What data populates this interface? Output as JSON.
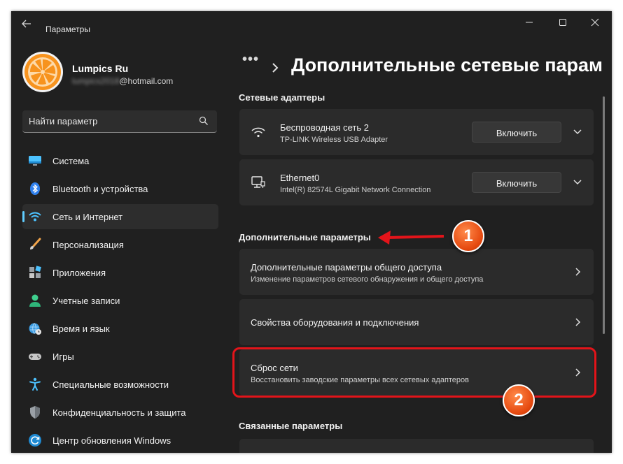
{
  "window": {
    "title": "Параметры"
  },
  "user": {
    "name": "Lumpics Ru",
    "email_hidden": "lumpics2018",
    "email_domain": "@hotmail.com"
  },
  "search": {
    "placeholder": "Найти параметр"
  },
  "nav": {
    "items": [
      {
        "label": "Система",
        "icon": "monitor-icon"
      },
      {
        "label": "Bluetooth и устройства",
        "icon": "bluetooth-icon"
      },
      {
        "label": "Сеть и Интернет",
        "icon": "wifi-icon",
        "active": true
      },
      {
        "label": "Персонализация",
        "icon": "brush-icon"
      },
      {
        "label": "Приложения",
        "icon": "apps-icon"
      },
      {
        "label": "Учетные записи",
        "icon": "person-icon"
      },
      {
        "label": "Время и язык",
        "icon": "globe-clock-icon"
      },
      {
        "label": "Игры",
        "icon": "gamepad-icon"
      },
      {
        "label": "Специальные возможности",
        "icon": "accessibility-icon"
      },
      {
        "label": "Конфиденциальность и защита",
        "icon": "shield-icon"
      },
      {
        "label": "Центр обновления Windows",
        "icon": "update-icon"
      }
    ]
  },
  "breadcrumb": {
    "dots": "•••",
    "title": "Дополнительные сетевые парам"
  },
  "sections": {
    "adapters": {
      "heading": "Сетевые адаптеры",
      "items": [
        {
          "title": "Беспроводная сеть 2",
          "subtitle": "TP-LINK Wireless USB Adapter",
          "button": "Включить",
          "icon": "wifi-icon"
        },
        {
          "title": "Ethernet0",
          "subtitle": "Intel(R) 82574L Gigabit Network Connection",
          "button": "Включить",
          "icon": "ethernet-icon"
        }
      ]
    },
    "advanced": {
      "heading": "Дополнительные параметры",
      "items": [
        {
          "title": "Дополнительные параметры общего доступа",
          "subtitle": "Изменение параметров сетевого обнаружения и общего доступа"
        },
        {
          "title": "Свойства оборудования и подключения"
        },
        {
          "title": "Сброс сети",
          "subtitle": "Восстановить заводские параметры всех сетевых адаптеров"
        }
      ]
    },
    "related": {
      "heading": "Связанные параметры"
    }
  },
  "annotations": {
    "badge1": "1",
    "badge2": "2"
  },
  "colors": {
    "accent": "#60cdff",
    "annotation": "#e3141a",
    "background": "#202020",
    "card": "#2b2b2b"
  }
}
